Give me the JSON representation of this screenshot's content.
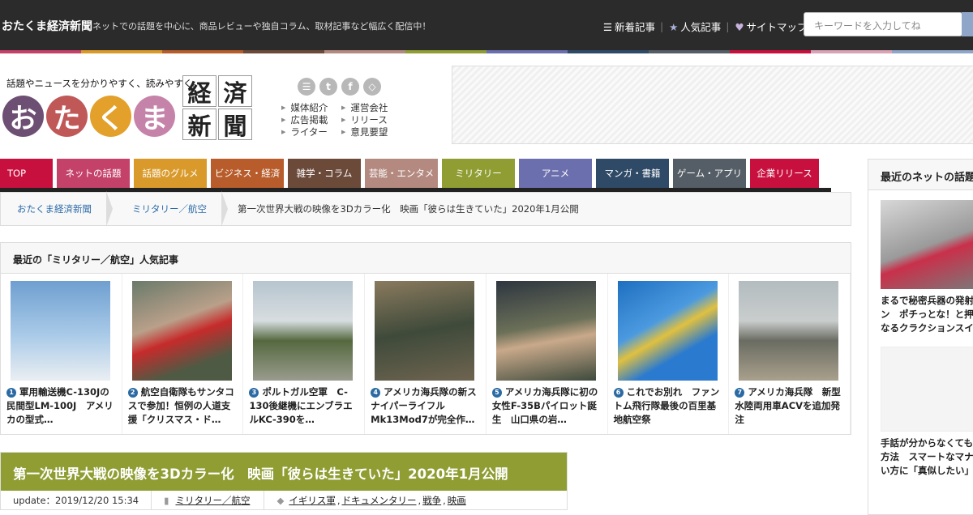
{
  "topbar": {
    "site_name": "おたくま経済新聞",
    "tagline": "ネットでの話題を中心に、商品レビューや独自コラム、取材記事など幅広く配信中！",
    "links": [
      {
        "icon": "list-icon",
        "label": "新着記事"
      },
      {
        "icon": "star-icon",
        "label": "人気記事"
      },
      {
        "icon": "heart-icon",
        "label": "サイトマップ"
      }
    ],
    "search_placeholder": "キーワードを入力してね"
  },
  "stripe_colors": [
    "#c4426a",
    "#d99a2b",
    "#b75c2a",
    "#6b4a3a",
    "#b48a80",
    "#8f9d33",
    "#6c6fae",
    "#2f4a66",
    "#555e66",
    "#c8103e",
    "#d9a3b5",
    "#8fa6c8"
  ],
  "header": {
    "catchphrase": "話題やニュースを分かりやすく、読みやすく。",
    "logo_chars": [
      {
        "char": "お",
        "color": "#6d4f73"
      },
      {
        "char": "た",
        "color": "#c05858"
      },
      {
        "char": "く",
        "color": "#e3a02b"
      },
      {
        "char": "ま",
        "color": "#c683a9"
      }
    ],
    "kanji": [
      "経",
      "済",
      "新",
      "聞"
    ],
    "social": [
      {
        "icon": "rss-icon",
        "glyph": "☰"
      },
      {
        "icon": "twitter-icon",
        "glyph": "t"
      },
      {
        "icon": "facebook-icon",
        "glyph": "f"
      },
      {
        "icon": "feedly-icon",
        "glyph": "◇"
      }
    ],
    "links_left": [
      "媒体紹介",
      "広告掲載",
      "ライター"
    ],
    "links_right": [
      "運営会社",
      "リリース",
      "意見要望"
    ]
  },
  "nav": [
    {
      "label": "TOP",
      "color": "#c8103e",
      "w": 65
    },
    {
      "label": "ネットの話題",
      "color": "#c4426a",
      "w": 90
    },
    {
      "label": "話題のグルメ",
      "color": "#d99a2b",
      "w": 90
    },
    {
      "label": "ビジネス・経済",
      "color": "#b75c2a",
      "w": 90
    },
    {
      "label": "雑学・コラム",
      "color": "#6b4a3a",
      "w": 90
    },
    {
      "label": "芸能・エンタメ",
      "color": "#b48a80",
      "w": 90
    },
    {
      "label": "ミリタリー",
      "color": "#8f9d33",
      "w": 90
    },
    {
      "label": "アニメ",
      "color": "#6c6fae",
      "w": 90
    },
    {
      "label": "マンガ・書籍",
      "color": "#2f4a66",
      "w": 90
    },
    {
      "label": "ゲーム・アプリ",
      "color": "#555e66",
      "w": 90
    },
    {
      "label": "企業リリース",
      "color": "#c8103e",
      "w": 85
    }
  ],
  "breadcrumb": {
    "items": [
      "おたくま経済新聞",
      "ミリタリー／航空"
    ],
    "current": "第一次世界大戦の映像を3Dカラー化　映画「彼らは生きていた」2020年1月公開"
  },
  "popular": {
    "heading": "最近の「ミリタリー／航空」人気記事",
    "items": [
      {
        "num": "1",
        "title": "軍用輸送機C-130Jの民間型LM-100J　アメリカの型式…",
        "bg": "linear-gradient(180deg,#6f9fd0 0%,#aacbe8 55%,#eaeef2 100%)"
      },
      {
        "num": "2",
        "title": "航空自衛隊もサンタコスで参加！恒例の人道支援「クリスマス・ド…",
        "bg": "linear-gradient(160deg,#6a7a6a,#b9a08a 40%,#c62b2b 55%,#4e5a44 80%)"
      },
      {
        "num": "3",
        "title": "ポルトガル空軍　C-130後継機にエンブラエルKC-390を…",
        "bg": "linear-gradient(180deg,#b7c5cf 0%,#d7dde0 40%,#55693f 60%,#9a9c8e 100%)"
      },
      {
        "num": "4",
        "title": "アメリカ海兵隊の新スナイパーライフル　Mk13Mod7が完全作…",
        "bg": "linear-gradient(170deg,#8a7a5e,#3f4a3a 50%,#6e6450)"
      },
      {
        "num": "5",
        "title": "アメリカ海兵隊に初の女性F-35Bパイロット誕生　山口県の岩…",
        "bg": "linear-gradient(170deg,#2e3640,#6b7058 45%,#c9a98a 60%,#3d4a3c)"
      },
      {
        "num": "6",
        "title": "これでお別れ　ファントム飛行隊最後の百里基地航空祭",
        "bg": "linear-gradient(150deg,#1e6fc0 0%,#4b9ae0 40%,#e0c040 52%,#2a7ad0 70%)"
      },
      {
        "num": "7",
        "title": "アメリカ海兵隊　新型水陸両用車ACVを追加発注",
        "bg": "linear-gradient(180deg,#b3bcc0 0%,#c9cdcc 40%,#6a6c62 60%,#a9a08c 100%)"
      }
    ]
  },
  "article": {
    "title": "第一次世界大戦の映像を3Dカラー化　映画「彼らは生きていた」2020年1月公開",
    "update_label": "update：",
    "update": "2019/12/20 15:34",
    "category": "ミリタリー／航空",
    "tags": [
      "イギリス軍",
      "ドキュメンタリー",
      "戦争",
      "映画"
    ]
  },
  "sidebar": {
    "heading": "最近のネットの話題",
    "items": [
      "まるで秘密兵器の発射ボ",
      "ン　ポチっとな！と押し",
      "なるクラクションスイッ"
    ],
    "items2": [
      "手話が分からなくても伝",
      "方法　スマートなマナー",
      "い方に「真似したい」"
    ]
  }
}
